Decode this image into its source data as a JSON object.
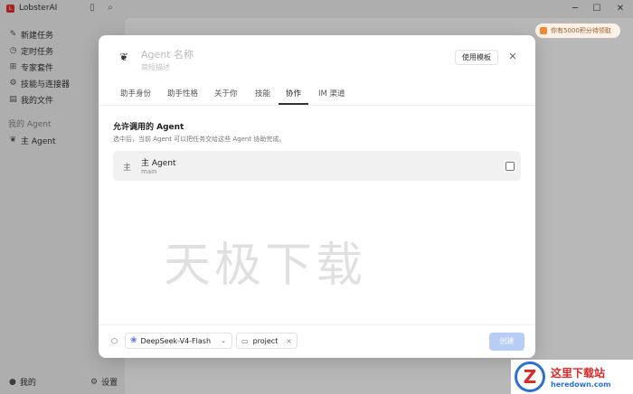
{
  "app": {
    "title": "LobsterAI",
    "logo_glyph": "L",
    "brand_color": "#e6332a"
  },
  "titlebar": {
    "sidebar_toggle_icon": "sidebar-icon",
    "search_icon": "search-icon",
    "minimize": "─",
    "maximize": "☐",
    "close": "✕"
  },
  "sidebar": {
    "items": [
      {
        "icon": "✎",
        "label": "新建任务"
      },
      {
        "icon": "◷",
        "label": "定时任务"
      },
      {
        "icon": "⊞",
        "label": "专家套件"
      },
      {
        "icon": "⚙",
        "label": "技能与连接器"
      },
      {
        "icon": "▤",
        "label": "我的文件"
      }
    ],
    "section_title": "我的 Agent",
    "agents": [
      {
        "icon": "❦",
        "label": "主 Agent"
      }
    ],
    "bottom": {
      "profile_icon": "●",
      "profile_label": "我的",
      "settings_icon": "⚙",
      "settings_label": "设置"
    }
  },
  "main": {
    "points_badge": "你有5000积分待领取"
  },
  "modal": {
    "avatar_glyph": "❦",
    "name_placeholder": "Agent 名称",
    "desc_placeholder": "简短描述",
    "template_button": "使用模板",
    "close_glyph": "✕",
    "tabs": [
      {
        "label": "助手身份",
        "active": false
      },
      {
        "label": "助手性格",
        "active": false
      },
      {
        "label": "关于你",
        "active": false
      },
      {
        "label": "技能",
        "active": false
      },
      {
        "label": "协作",
        "active": true
      },
      {
        "label": "IM 渠道",
        "active": false
      }
    ],
    "collab": {
      "title": "允许调用的 Agent",
      "description": "选中后，当前 Agent 可以把任务交给这些 Agent 协助完成。",
      "agents": [
        {
          "icon": "主",
          "name": "主 Agent",
          "id": "main",
          "checked": false
        }
      ]
    },
    "footer": {
      "cube_icon": "⬡",
      "model_icon": "❀",
      "model": "DeepSeek-V4-Flash",
      "chevron": "⌄",
      "folder_icon": "▭",
      "project": "project",
      "remove_glyph": "×",
      "create_button": "创建"
    }
  },
  "watermark": {
    "text": "天极下载"
  },
  "site_logo": {
    "badge": "Z",
    "name": "这里下载站",
    "domain": "heredown.com"
  }
}
